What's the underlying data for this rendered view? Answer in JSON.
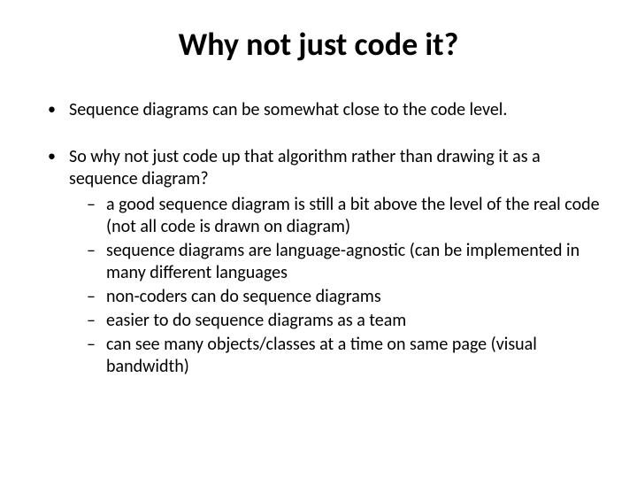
{
  "title": "Why not just code it?",
  "bullets": [
    {
      "text": "Sequence diagrams can be somewhat close to the code level.",
      "sub": []
    },
    {
      "text": "So why not just code up that algorithm rather than drawing it as a sequence diagram?",
      "sub": [
        "a good sequence diagram is still a bit above the level of the real code (not all code is drawn on diagram)",
        "sequence diagrams are language-agnostic (can be implemented in many different languages",
        "non-coders can do sequence diagrams",
        "easier to do sequence diagrams as a team",
        "can see many objects/classes at a time on same page (visual bandwidth)"
      ]
    }
  ]
}
